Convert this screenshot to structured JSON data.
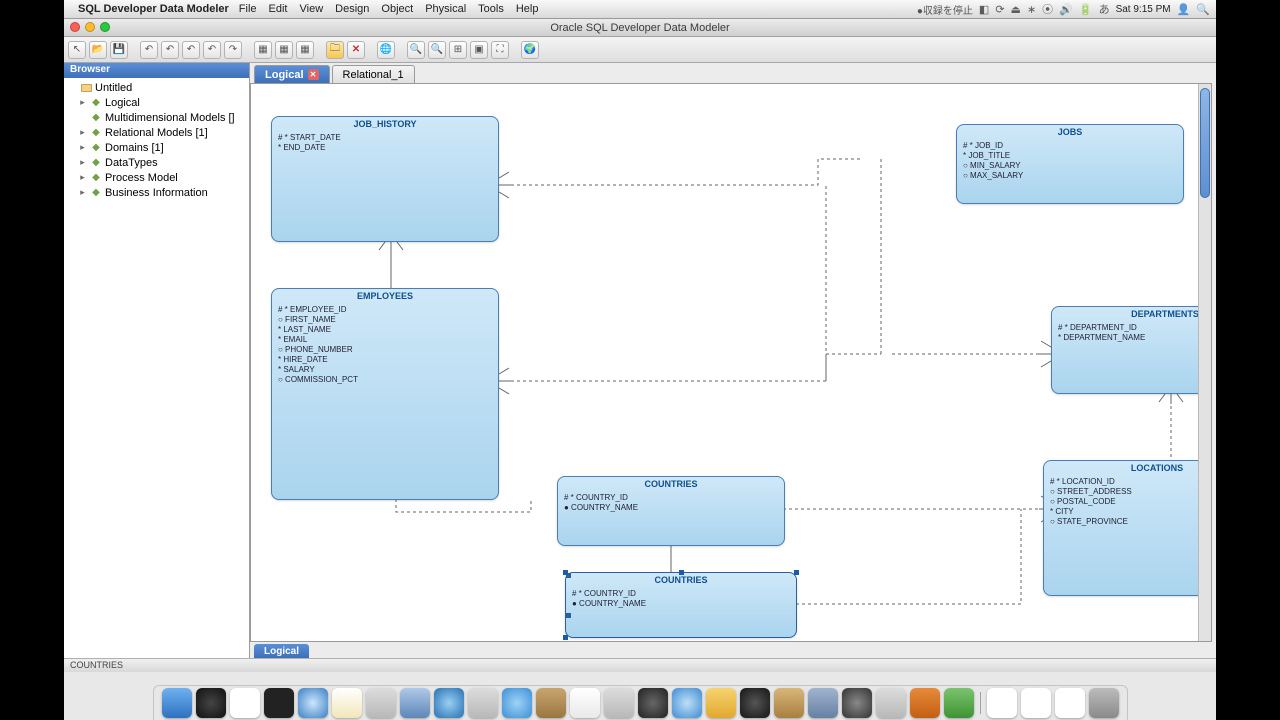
{
  "menubar": {
    "app": "SQL Developer Data Modeler",
    "items": [
      "File",
      "Edit",
      "View",
      "Design",
      "Object",
      "Physical",
      "Tools",
      "Help"
    ],
    "clock": "Sat 9:15 PM",
    "rec_label": "●収録を停止"
  },
  "window": {
    "title": "Oracle SQL Developer Data Modeler"
  },
  "sidebar": {
    "title": "Browser",
    "tree": [
      {
        "label": "Untitled",
        "icon": "folder",
        "tw": ""
      },
      {
        "label": "Logical",
        "icon": "db",
        "tw": "▸",
        "indent": 1
      },
      {
        "label": "Multidimensional Models []",
        "icon": "db",
        "tw": "",
        "indent": 1
      },
      {
        "label": "Relational Models [1]",
        "icon": "db",
        "tw": "▸",
        "indent": 1
      },
      {
        "label": "Domains [1]",
        "icon": "db",
        "tw": "▸",
        "indent": 1
      },
      {
        "label": "DataTypes",
        "icon": "db",
        "tw": "▸",
        "indent": 1
      },
      {
        "label": "Process Model",
        "icon": "db",
        "tw": "▸",
        "indent": 1
      },
      {
        "label": "Business Information",
        "icon": "db",
        "tw": "▸",
        "indent": 1
      }
    ]
  },
  "tabs": {
    "active": "Logical",
    "other": "Relational_1"
  },
  "entities": {
    "job_history": {
      "title": "JOB_HISTORY",
      "attrs": [
        "# * START_DATE",
        "* END_DATE"
      ]
    },
    "jobs": {
      "title": "JOBS",
      "attrs": [
        "# * JOB_ID",
        "* JOB_TITLE",
        "○ MIN_SALARY",
        "○ MAX_SALARY"
      ]
    },
    "employees": {
      "title": "EMPLOYEES",
      "attrs": [
        "# * EMPLOYEE_ID",
        "○ FIRST_NAME",
        "* LAST_NAME",
        "* EMAIL",
        "○ PHONE_NUMBER",
        "* HIRE_DATE",
        "* SALARY",
        "○ COMMISSION_PCT"
      ]
    },
    "departments": {
      "title": "DEPARTMENTS",
      "attrs": [
        "# * DEPARTMENT_ID",
        "* DEPARTMENT_NAME"
      ]
    },
    "countries1": {
      "title": "COUNTRIES",
      "attrs": [
        "# * COUNTRY_ID",
        "● COUNTRY_NAME"
      ]
    },
    "countries2": {
      "title": "COUNTRIES",
      "attrs": [
        "# * COUNTRY_ID",
        "● COUNTRY_NAME"
      ]
    },
    "locations": {
      "title": "LOCATIONS",
      "attrs": [
        "# * LOCATION_ID",
        "○ STREET_ADDRESS",
        "○ POSTAL_CODE",
        "* CITY",
        "○ STATE_PROVINCE"
      ]
    }
  },
  "footer_tab": "Logical",
  "status": "COUNTRIES",
  "toolbar_icons": [
    "pointer",
    "open",
    "save",
    "sep",
    "undo-1",
    "undo-2",
    "undo-3",
    "undo-4",
    "redo",
    "sep",
    "grid-1",
    "grid-2",
    "grid-3",
    "sep",
    "folder-y",
    "close-red",
    "sep",
    "globe",
    "sep",
    "zoom-in",
    "zoom-out",
    "fit",
    "region",
    "full",
    "sep",
    "world"
  ]
}
